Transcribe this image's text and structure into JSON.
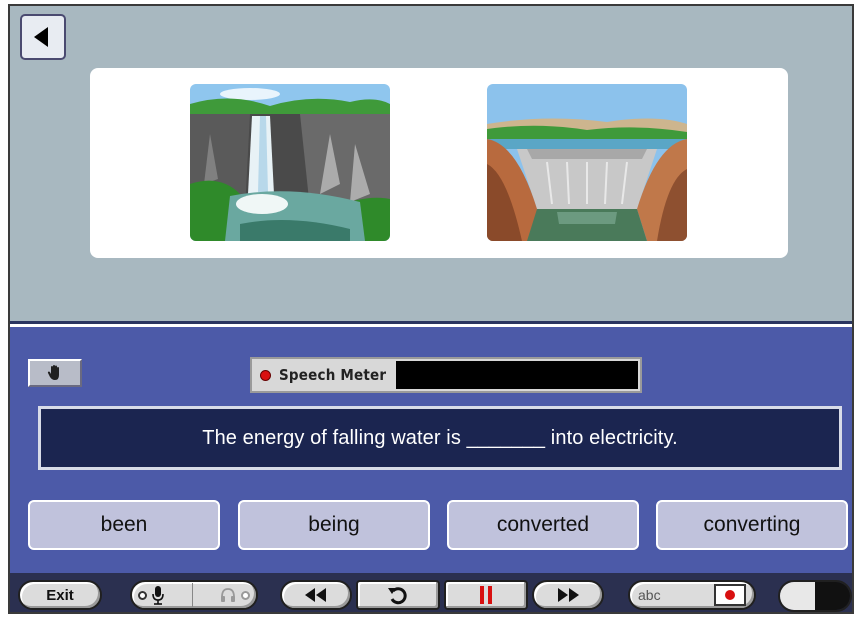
{
  "toolbar_top": {
    "back_icon": "back-triangle-icon"
  },
  "scene": {
    "images": [
      {
        "name": "waterfall-image",
        "icon": "waterfall-picture"
      },
      {
        "name": "dam-image",
        "icon": "hydro-dam-picture"
      }
    ]
  },
  "exercise": {
    "hand_icon": "hand-icon",
    "speech_meter": {
      "label": "Speech Meter",
      "level": 0
    },
    "sentence": "The energy of falling water is _______ into electricity.",
    "choices": [
      "been",
      "being",
      "converted",
      "converting"
    ]
  },
  "controls": {
    "exit_label": "Exit",
    "abc_label": "abc",
    "icons": [
      "mic-icon",
      "headphones-icon",
      "rewind-icon",
      "replay-icon",
      "pause-icon",
      "fast-forward-icon",
      "record-icon",
      "toggle-switch"
    ]
  },
  "colors": {
    "accent_pause": "#d81010",
    "panel": "#4c5aa8",
    "sentence_bg": "#1b2550"
  }
}
